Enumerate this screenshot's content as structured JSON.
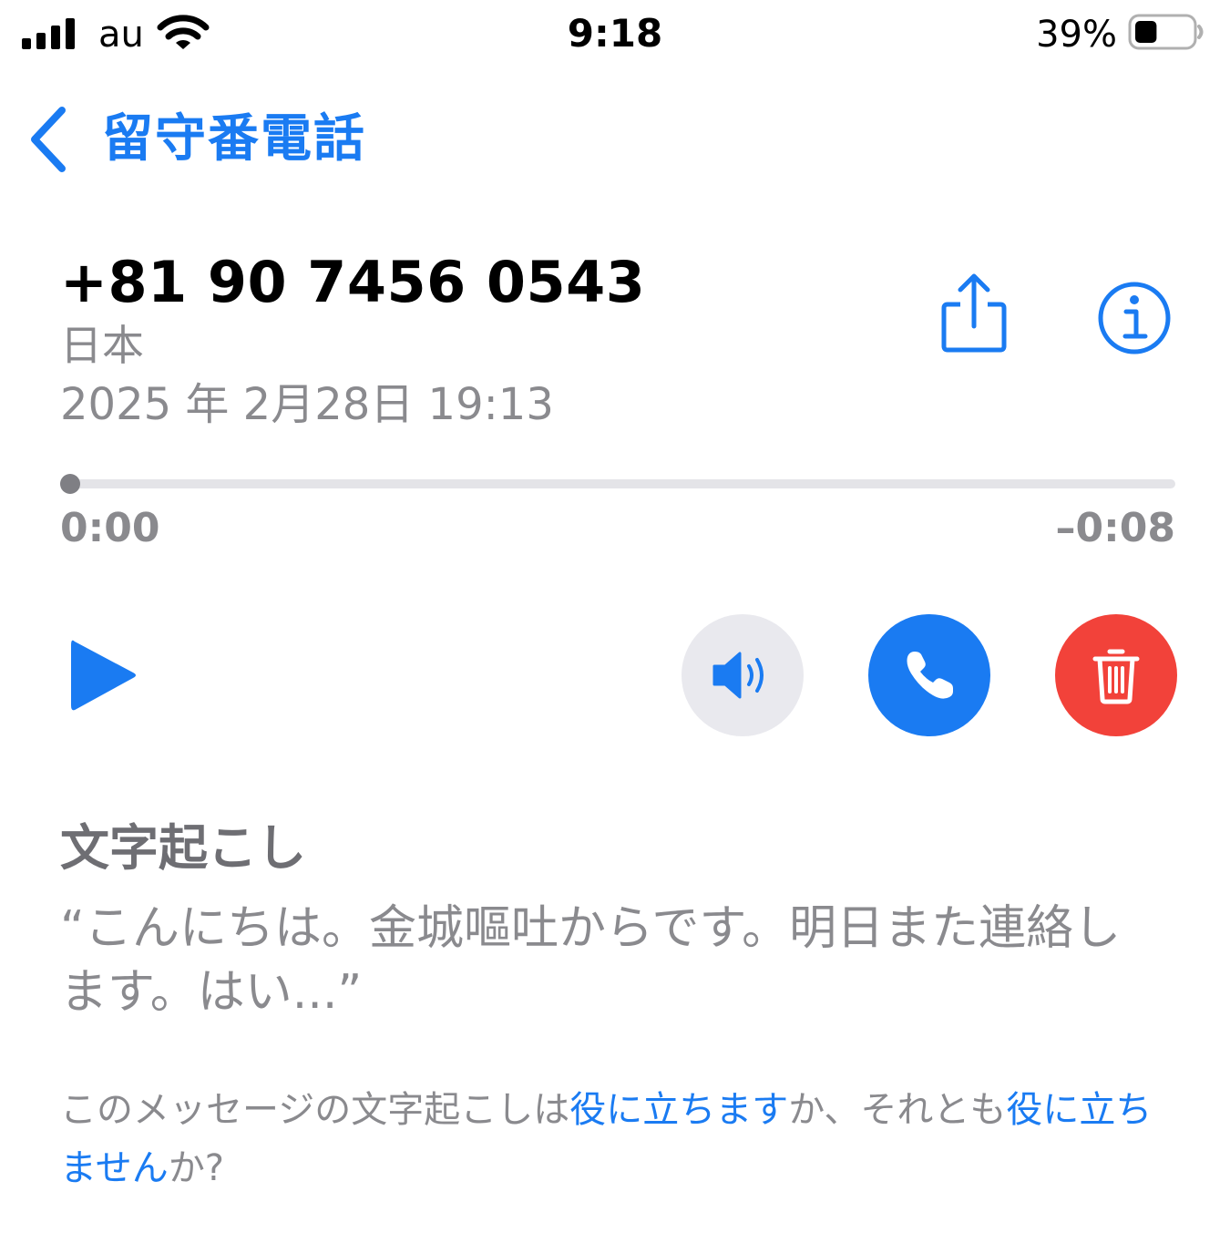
{
  "status_bar": {
    "carrier": "au",
    "time": "9:18",
    "battery_percent": "39%",
    "battery_level": 0.39,
    "icons": [
      "cellular-signal-icon",
      "wifi-icon",
      "battery-icon"
    ]
  },
  "nav": {
    "back_label": "留守番電話"
  },
  "voicemail": {
    "number": "+81 90 7456 0543",
    "location": "日本",
    "datetime": "2025 年 2月28日 19:13"
  },
  "player": {
    "elapsed": "0:00",
    "remaining": "–0:08",
    "progress": 0.0
  },
  "actions": {
    "icons": [
      "play-icon",
      "speaker-icon",
      "phone-icon",
      "trash-icon",
      "share-icon",
      "info-icon"
    ]
  },
  "transcription": {
    "heading": "文字起こし",
    "text": "“こんにちは。金城嘔吐からです。明日また連絡します。はい...”"
  },
  "feedback": {
    "prefix": "このメッセージの文字起こしは",
    "useful_link": "役に立ちます",
    "middle": "か、それとも",
    "not_useful_link": "役に立ちません",
    "suffix": "か?"
  },
  "colors": {
    "accent": "#1a7bf2",
    "delete": "#f2423a",
    "secondary_text": "#8a8a8e",
    "speaker_bg": "#e9e9ee"
  }
}
